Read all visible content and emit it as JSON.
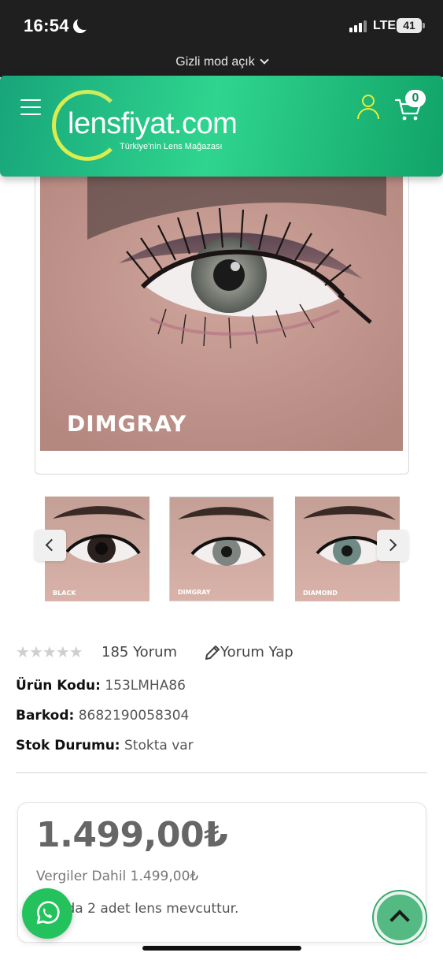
{
  "status_bar": {
    "time": "16:54",
    "network": "LTE",
    "battery": "41"
  },
  "browser": {
    "incognito_label": "Gizli mod açık"
  },
  "header": {
    "logo_text": "lensfiyat.com",
    "tagline": "Türkiye'nin Lens Mağazası",
    "cart_count": "0",
    "icons": [
      "menu-icon",
      "user-icon",
      "cart-icon"
    ],
    "accent_color": "#2fd58e",
    "icon_color": "#e4ef3c"
  },
  "product": {
    "main_image_label": "DIMGRAY",
    "thumbnails": [
      {
        "label": "BLACK"
      },
      {
        "label": "DIMGRAY"
      },
      {
        "label": "DIAMOND"
      }
    ],
    "rating_stars": 5,
    "review_count_text": "185 Yorum",
    "write_review_text": "Yorum Yap",
    "code_label": "Ürün Kodu:",
    "code_value": "153LMHA86",
    "barcode_label": "Barkod:",
    "barcode_value": "8682190058304",
    "stock_label": "Stok Durumu:",
    "stock_value": "Stokta var",
    "price": "1.499,00₺",
    "tax_note": "Vergiler Dahil 1.499,00₺",
    "box_note": "Kutuda 2 adet lens mevcuttur."
  }
}
